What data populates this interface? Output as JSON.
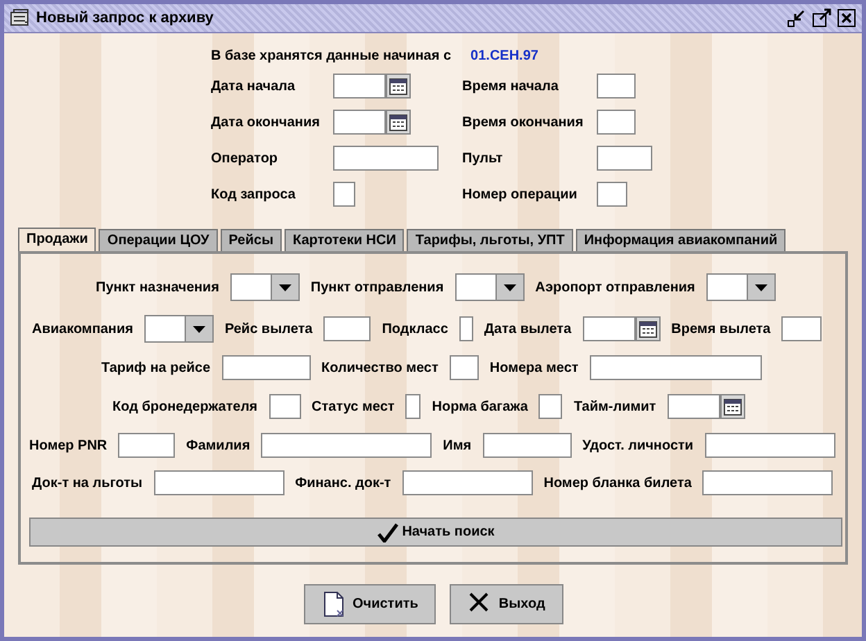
{
  "window": {
    "title": "Новый запрос к архиву"
  },
  "header": {
    "label": "В базе хранятся данные начиная с",
    "date": "01.СЕН.97"
  },
  "top_fields": [
    {
      "label": "Дата начала",
      "kind": "date"
    },
    {
      "label": "Время начала",
      "kind": "text"
    },
    {
      "label": "Дата окончания",
      "kind": "date"
    },
    {
      "label": "Время окончания",
      "kind": "text"
    },
    {
      "label": "Оператор",
      "kind": "text"
    },
    {
      "label": "Пульт",
      "kind": "text"
    },
    {
      "label": "Код запроса",
      "kind": "text"
    },
    {
      "label": "Номер операции",
      "kind": "text"
    }
  ],
  "tabs": [
    {
      "label": "Продажи",
      "selected": true
    },
    {
      "label": "Операции ЦОУ",
      "selected": false
    },
    {
      "label": "Рейсы",
      "selected": false
    },
    {
      "label": "Картотеки НСИ",
      "selected": false
    },
    {
      "label": "Тарифы, льготы, УПТ",
      "selected": false
    },
    {
      "label": "Информация авиакомпаний",
      "selected": false
    }
  ],
  "panel_rows": [
    [
      {
        "label": "Пункт назначения",
        "kind": "combo"
      },
      {
        "label": "Пункт отправления",
        "kind": "combo"
      },
      {
        "label": "Аэропорт отправления",
        "kind": "combo"
      }
    ],
    [
      {
        "label": "Авиакомпания",
        "kind": "combo"
      },
      {
        "label": "Рейс вылета",
        "kind": "text"
      },
      {
        "label": "Подкласс",
        "kind": "text"
      },
      {
        "label": "Дата вылета",
        "kind": "date"
      },
      {
        "label": "Время вылета",
        "kind": "text"
      }
    ],
    [
      {
        "label": "Тариф на рейсе",
        "kind": "text"
      },
      {
        "label": "Количество мест",
        "kind": "text"
      },
      {
        "label": "Номера мест",
        "kind": "text"
      }
    ],
    [
      {
        "label": "Код бронедержателя",
        "kind": "text"
      },
      {
        "label": "Статус мест",
        "kind": "text"
      },
      {
        "label": "Норма багажа",
        "kind": "text"
      },
      {
        "label": "Тайм-лимит",
        "kind": "date"
      }
    ],
    [
      {
        "label": "Номер PNR",
        "kind": "text"
      },
      {
        "label": "Фамилия",
        "kind": "text"
      },
      {
        "label": "Имя",
        "kind": "text"
      },
      {
        "label": "Удост. личности",
        "kind": "text"
      }
    ],
    [
      {
        "label": "Док-т на льготы",
        "kind": "text"
      },
      {
        "label": "Финанс. док-т",
        "kind": "text"
      },
      {
        "label": "Номер бланка билета",
        "kind": "text"
      }
    ]
  ],
  "search_button": "Начать поиск",
  "buttons": [
    {
      "label": "Очистить",
      "kind": "clear"
    },
    {
      "label": "Выход",
      "kind": "exit"
    }
  ]
}
